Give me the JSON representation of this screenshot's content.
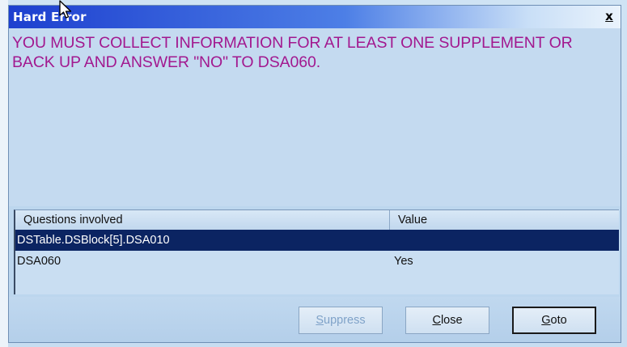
{
  "window": {
    "title": "Hard Error",
    "close_glyph": "x"
  },
  "message": {
    "text": "YOU MUST COLLECT INFORMATION FOR AT LEAST ONE SUPPLEMENT OR BACK UP AND ANSWER \"NO\" TO DSA060.",
    "color": "#a2188f"
  },
  "table": {
    "columns": [
      "Questions involved",
      "Value"
    ],
    "rows": [
      {
        "question": "DSTable.DSBlock[5].DSA010",
        "value": "",
        "selected": true
      },
      {
        "question": "DSA060",
        "value": "Yes",
        "selected": false
      }
    ]
  },
  "buttons": {
    "suppress": {
      "mnemonic": "S",
      "rest": "uppress",
      "enabled": false
    },
    "close": {
      "mnemonic": "C",
      "rest": "lose",
      "enabled": true
    },
    "goto": {
      "mnemonic": "G",
      "rest": "oto",
      "enabled": true,
      "default": true
    }
  },
  "colors": {
    "titlebar_start": "#1d3fcf",
    "selection": "#0b2462",
    "dialog_bg": "#c4daf0"
  },
  "icons": {
    "cursor": "mouse-pointer-icon",
    "close": "close-icon"
  }
}
